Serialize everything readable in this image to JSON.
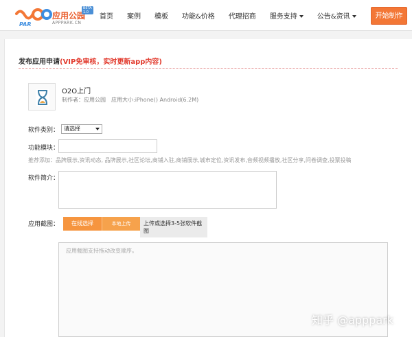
{
  "header": {
    "logo": {
      "name": "应用公园",
      "sub": "APPPARK.CN",
      "beta": "BETA 1.0"
    },
    "nav": [
      {
        "label": "首页"
      },
      {
        "label": "案例"
      },
      {
        "label": "模板"
      },
      {
        "label": "功能&价格"
      },
      {
        "label": "代理招商"
      },
      {
        "label": "服务支持",
        "dropdown": true
      },
      {
        "label": "公告&资讯",
        "dropdown": true
      }
    ],
    "start_button": "开始制作"
  },
  "form": {
    "title": "发布应用申请",
    "title_note": "(VIP免审核，实时更新app内容)",
    "app": {
      "name": "O2O上门",
      "meta": "制作者：应用公园　应用大小:iPhone() Android(6.2M)"
    },
    "category_label": "软件类别：",
    "category_value": "请选择",
    "module_label": "功能模块：",
    "module_value": "",
    "hint": "推荐添加：品牌展示,资讯动态, 品牌展示,社区论坛,商铺入驻,商铺展示,城市定位,资讯发布,音频视频播放,社区分享,问卷调查,投票投稿",
    "intro_label": "软件简介：",
    "screenshot_label": "应用截图：",
    "online_button": "在线选择",
    "local_button": "本地上传",
    "upload_tip": "上传或选择3-5张软件截图",
    "screens_placeholder": "应用截图支持拖动改变顺序。"
  },
  "watermark": "知乎 @apppark",
  "colors": {
    "accent": "#f37736",
    "title_note": "#e23b2e",
    "beta": "#4a8fd6"
  }
}
